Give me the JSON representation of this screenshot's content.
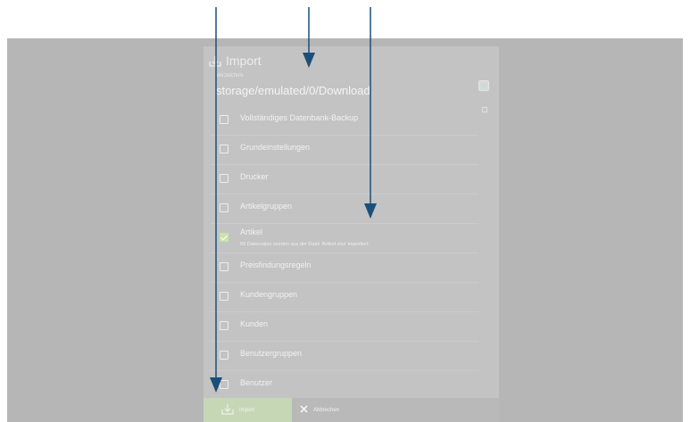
{
  "dialog": {
    "title": "Import",
    "title_icon": "import-tray-icon",
    "directory": {
      "label": "Verzeichnis",
      "value": "storage/emulated/0/Download",
      "browse_icon": "folder-icon"
    },
    "items": [
      {
        "label": "Vollständiges Datenbank-Backup",
        "checked": false,
        "sub": ""
      },
      {
        "label": "Grundeinstellungen",
        "checked": false,
        "sub": ""
      },
      {
        "label": "Drucker",
        "checked": false,
        "sub": ""
      },
      {
        "label": "Artikelgruppen",
        "checked": false,
        "sub": ""
      },
      {
        "label": "Artikel",
        "checked": true,
        "sub": "59 Datensätze werden aus der Datei 'Artikel.xlsx' importiert"
      },
      {
        "label": "Preisfindungsregeln",
        "checked": false,
        "sub": ""
      },
      {
        "label": "Kundengruppen",
        "checked": false,
        "sub": ""
      },
      {
        "label": "Kunden",
        "checked": false,
        "sub": ""
      },
      {
        "label": "Benutzergruppen",
        "checked": false,
        "sub": ""
      },
      {
        "label": "Benutzer",
        "checked": false,
        "sub": ""
      }
    ],
    "footer": {
      "import_label": "Import",
      "import_icon": "import-tray-icon",
      "cancel_label": "Abbrechen",
      "cancel_icon": "close-x-icon"
    }
  },
  "colors": {
    "backdrop": "#b6b6b6",
    "dialog": "#c3c3c3",
    "import_button": "#c6d7b6",
    "arrow": "#1a4f7a"
  }
}
